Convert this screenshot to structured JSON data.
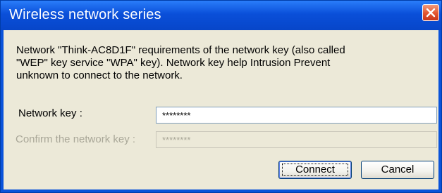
{
  "window": {
    "title": "Wireless network series"
  },
  "dialog": {
    "message": "Network \"Think-AC8D1F\" requirements of the network key (also called\n\"WEP\" key service \"WPA\" key). Network key help Intrusion Prevent\nunknown to connect to the network.",
    "network_key_label": "Network key :",
    "network_key_value": "********",
    "confirm_label": "Confirm the network key :",
    "confirm_value": "********",
    "connect_label": "Connect",
    "cancel_label": "Cancel"
  },
  "colors": {
    "titlebar": "#0a4fd9",
    "background": "#ece9d8",
    "close_button": "#e2552f"
  }
}
